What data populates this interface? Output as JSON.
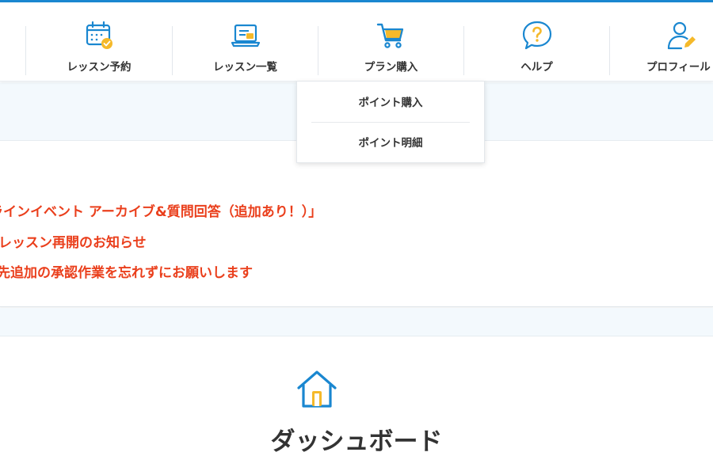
{
  "colors": {
    "accent": "#1a87d0",
    "icon_blue": "#1a87d0",
    "icon_yellow": "#f5b92a",
    "news_red": "#ea3f1c",
    "band_bg": "#f3f9fd",
    "text": "#333333"
  },
  "nav": {
    "items": [
      {
        "label": "レッスン予約",
        "icon": "calendar-check-icon"
      },
      {
        "label": "レッスン一覧",
        "icon": "laptop-icon"
      },
      {
        "label": "プラン購入",
        "icon": "shopping-cart-icon"
      },
      {
        "label": "ヘルプ",
        "icon": "help-bubble-icon"
      },
      {
        "label": "プロフィール",
        "icon": "user-edit-icon"
      }
    ]
  },
  "dropdown": {
    "items": [
      {
        "label": "ポイント購入"
      },
      {
        "label": "ポイント明細"
      }
    ]
  },
  "news": {
    "items": [
      {
        "text": "ンラインイベント アーカイブ&質問回答（追加あり！）」"
      },
      {
        "text": "レッスン再開のお知らせ"
      },
      {
        "text": "先追加の承認作業を忘れずにお願いします"
      }
    ]
  },
  "dashboard": {
    "title": "ダッシュボード",
    "icon": "home-icon"
  }
}
